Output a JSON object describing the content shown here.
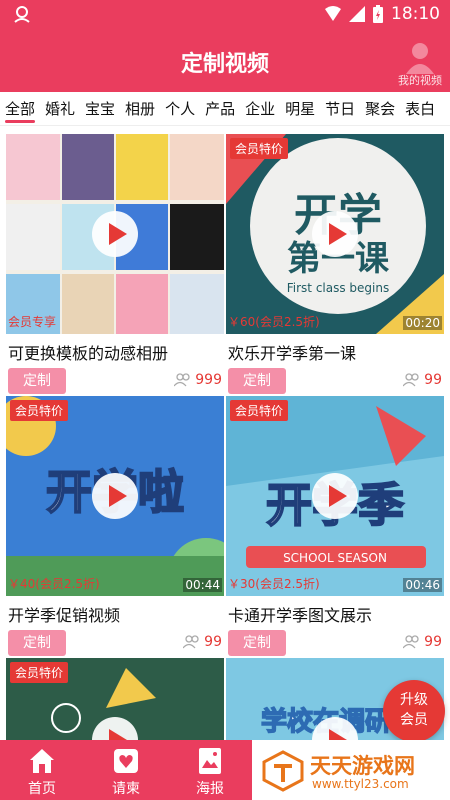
{
  "status_bar": {
    "time": "18:10"
  },
  "header": {
    "title": "定制视频",
    "my_video_label": "我的视频"
  },
  "tabs": [
    {
      "label": "全部",
      "active": true
    },
    {
      "label": "婚礼"
    },
    {
      "label": "宝宝"
    },
    {
      "label": "相册"
    },
    {
      "label": "个人"
    },
    {
      "label": "产品"
    },
    {
      "label": "企业"
    },
    {
      "label": "明星"
    },
    {
      "label": "节日"
    },
    {
      "label": "聚会"
    },
    {
      "label": "表白"
    }
  ],
  "cards": [
    {
      "badge": "",
      "price": "会员专享",
      "duration": "",
      "title": "可更换模板的动感相册",
      "button": "定制",
      "count": "999"
    },
    {
      "badge": "会员特价",
      "price": "￥60(会员2.5折)",
      "duration": "00:20",
      "title": "欢乐开学季第一课",
      "button": "定制",
      "count": "99",
      "thumb_text_1": "开学",
      "thumb_text_2": "第一课",
      "thumb_text_3": "First class begins"
    },
    {
      "badge": "会员特价",
      "price": "￥40(会员2.5折)",
      "duration": "00:44",
      "title": "开学季促销视频",
      "button": "定制",
      "count": "99",
      "thumb_text_1": "开学啦"
    },
    {
      "badge": "会员特价",
      "price": "￥30(会员2.5折)",
      "duration": "00:46",
      "title": "卡通开学季图文展示",
      "button": "定制",
      "count": "99",
      "thumb_text_1": "开学季",
      "thumb_text_2": "SCHOOL SEASON"
    },
    {
      "badge": "会员特价",
      "price": "",
      "duration": "",
      "title": "",
      "button": "",
      "count": ""
    },
    {
      "badge": "",
      "price": "",
      "duration": "",
      "title": "",
      "button": "",
      "count": "",
      "thumb_text_1": "学校在调研"
    }
  ],
  "upgrade": {
    "line1": "升级",
    "line2": "会员"
  },
  "bottom_nav": [
    {
      "label": "首页",
      "icon": "home-icon"
    },
    {
      "label": "请柬",
      "icon": "heart-card-icon"
    },
    {
      "label": "海报",
      "icon": "poster-icon"
    }
  ],
  "watermark": {
    "name": "天天游戏网",
    "url": "www.ttyl23.com"
  },
  "colors": {
    "primary": "#ea3d5e",
    "badge": "#e53935",
    "button": "#f48fa8",
    "watermark": "#e8751a"
  }
}
